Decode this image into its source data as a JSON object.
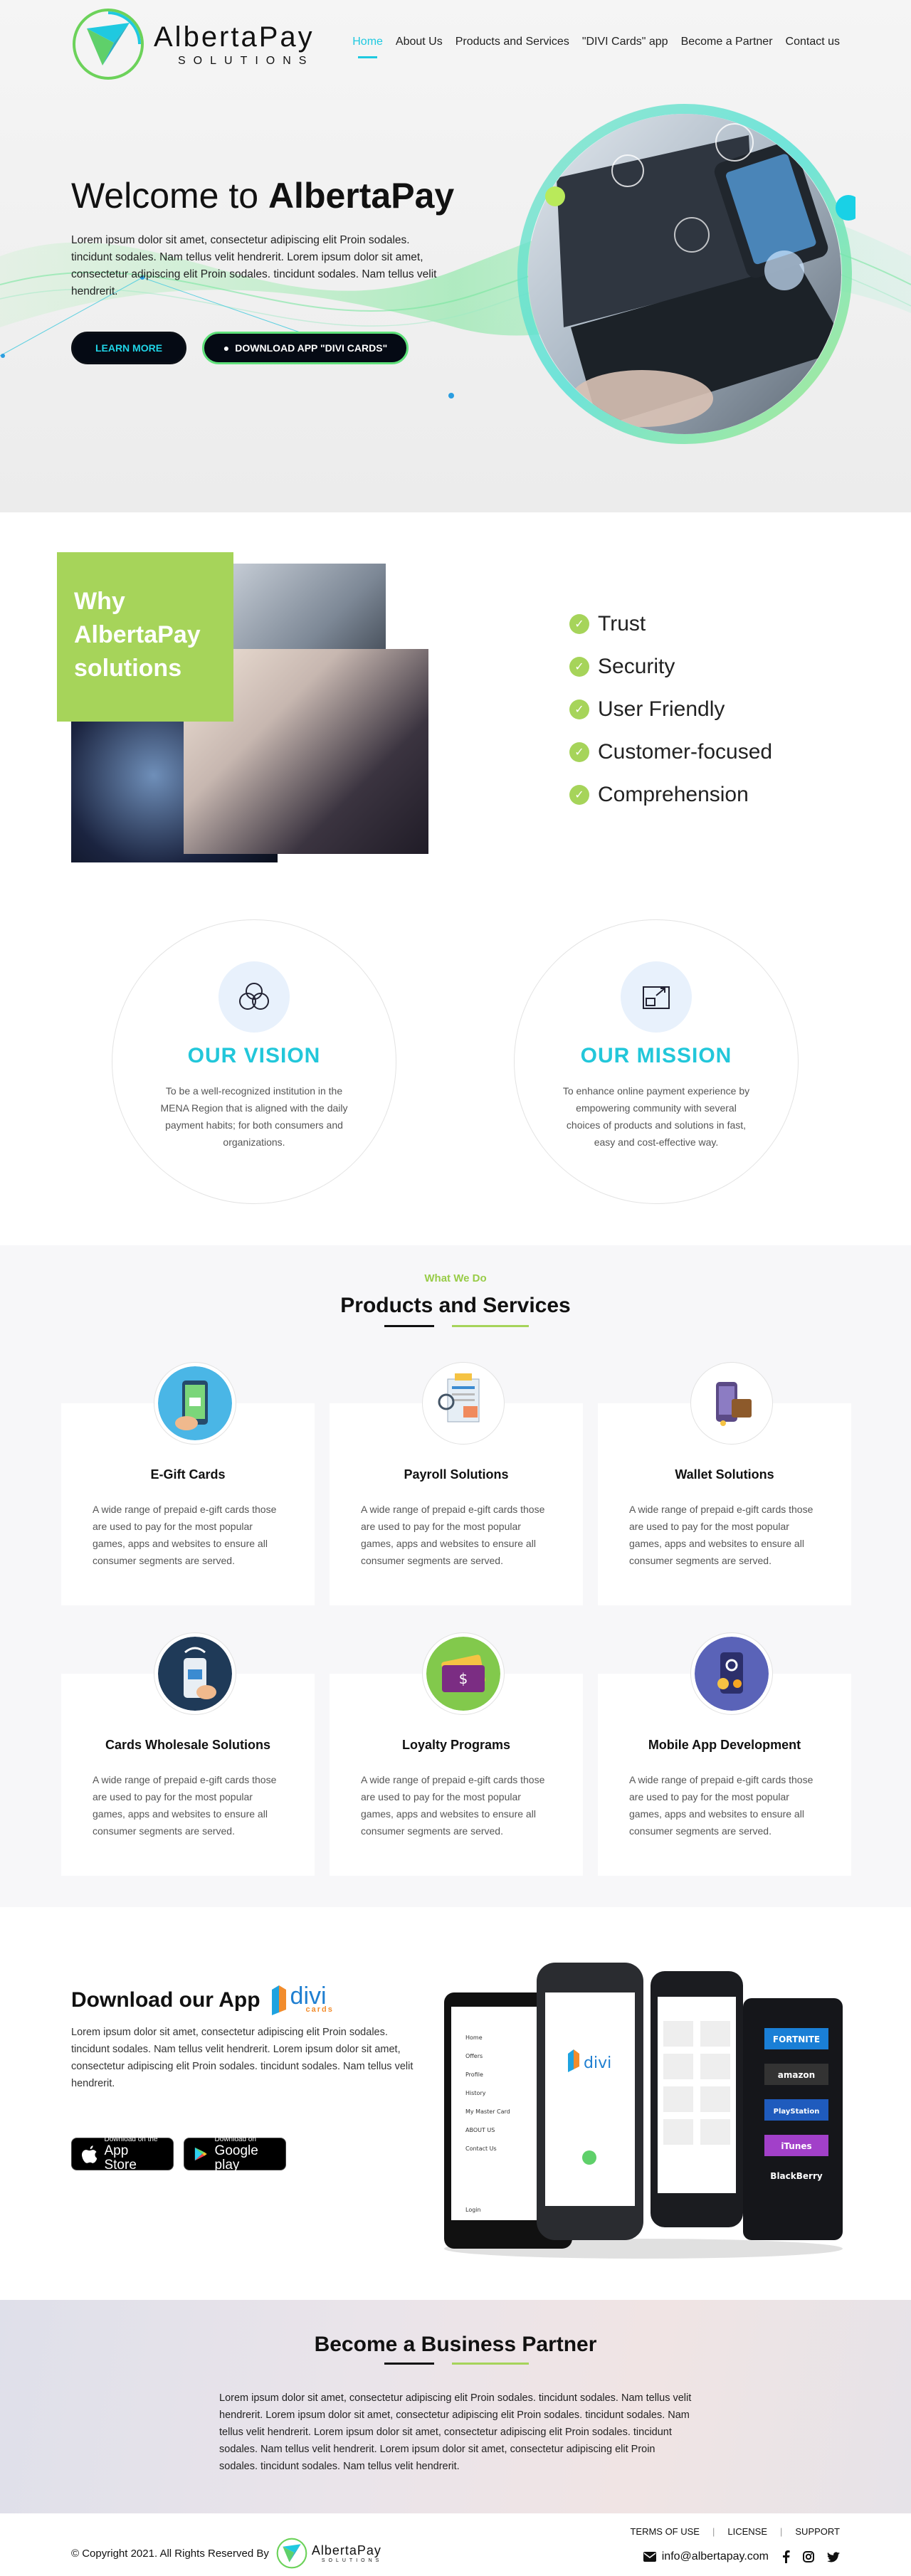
{
  "brand": {
    "name": "AlbertaPay",
    "tagline": "SOLUTIONS"
  },
  "nav": {
    "items": [
      "Home",
      "About Us",
      "Products and Services",
      "\"DIVI Cards\" app",
      "Become a Partner",
      "Contact us"
    ],
    "active_index": 0
  },
  "hero": {
    "title_light": "Welcome to ",
    "title_bold": "AlbertaPay",
    "text": "Lorem ipsum dolor sit amet, consectetur adipiscing elit Proin sodales. tincidunt sodales. Nam tellus velit hendrerit. Lorem ipsum dolor sit amet, consectetur adipiscing elit Proin sodales. tincidunt sodales. Nam tellus velit hendrerit.",
    "learn_more": "LEARN MORE",
    "download": "DOWNLOAD APP \"DIVI CARDS\""
  },
  "why": {
    "heading_lines": [
      "Why",
      "AlbertaPay",
      "solutions"
    ],
    "items": [
      "Trust",
      "Security",
      "User Friendly",
      "Customer-focused",
      "Comprehension"
    ]
  },
  "vision": {
    "title": "OUR VISION",
    "text": "To be a well-recognized institution in the MENA Region that is aligned with the daily payment habits; for both consumers and organizations."
  },
  "mission": {
    "title": "OUR MISSION",
    "text": "To enhance online payment experience by empowering community with several choices of products and solutions in fast, easy and cost-effective way."
  },
  "products": {
    "kicker": "What We Do",
    "title": "Products and Services",
    "items": [
      {
        "title": "E-Gift Cards",
        "text": "A wide range of prepaid e-gift cards those are used to pay for the most popular games, apps and websites to ensure all consumer segments are served."
      },
      {
        "title": "Payroll Solutions",
        "text": "A wide range of prepaid e-gift cards those are used to pay for the most popular games, apps and websites to ensure all consumer segments are served."
      },
      {
        "title": "Wallet Solutions",
        "text": "A wide range of prepaid e-gift cards those are used to pay for the most popular games, apps and websites to ensure all consumer segments are served."
      },
      {
        "title": "Cards Wholesale Solutions",
        "text": "A wide range of prepaid e-gift cards those are used to pay for the most popular games, apps and websites to ensure all consumer segments are served."
      },
      {
        "title": "Loyalty Programs",
        "text": "A wide range of prepaid e-gift cards those are used to pay for the most popular games, apps and websites to ensure all consumer segments are served."
      },
      {
        "title": "Mobile App Development",
        "text": "A wide range of prepaid e-gift cards those are used to pay for the most popular games, apps and websites to ensure all consumer segments are served."
      }
    ]
  },
  "app": {
    "title": "Download our App",
    "divi": "divi",
    "divi_sub": "cards",
    "text": "Lorem ipsum dolor sit amet, consectetur adipiscing elit Proin sodales. tincidunt sodales. Nam tellus velit hendrerit. Lorem ipsum dolor sit amet, consectetur adipiscing elit Proin sodales. tincidunt sodales. Nam tellus velit hendrerit.",
    "appstore_small": "Download on the",
    "appstore_big": "App Store",
    "gplay_small": "Download on",
    "gplay_big": "Google play",
    "phone_menu": [
      "Home",
      "Offers",
      "Profile",
      "History",
      "My Master Card",
      "ABOUT US",
      "Contact Us",
      "Login"
    ],
    "phone_brands": [
      "FORTNITE",
      "amazon",
      "PlayStation",
      "iTunes",
      "BlackBerry"
    ]
  },
  "partner": {
    "title": "Become a Business Partner",
    "text": "Lorem ipsum dolor sit amet, consectetur adipiscing elit Proin sodales. tincidunt sodales. Nam tellus velit hendrerit. Lorem ipsum dolor sit amet, consectetur adipiscing elit Proin sodales. tincidunt sodales. Nam tellus velit hendrerit. Lorem ipsum dolor sit amet, consectetur adipiscing elit Proin sodales. tincidunt sodales. Nam tellus velit hendrerit. Lorem ipsum dolor sit amet, consectetur adipiscing elit Proin sodales. tincidunt sodales. Nam tellus velit hendrerit."
  },
  "footer": {
    "copyright": "© Copyright 2021. All Rights Reserved By",
    "links": [
      "TERMS OF USE",
      "LICENSE",
      "SUPPORT"
    ],
    "email": "info@albertapay.com",
    "social_icons": [
      "facebook-icon",
      "instagram-icon",
      "twitter-icon"
    ]
  },
  "colors": {
    "cyan": "#1fc9e0",
    "green": "#a6d45a",
    "dark": "#050a14"
  }
}
